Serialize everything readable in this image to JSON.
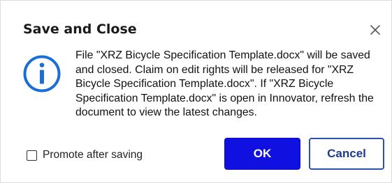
{
  "dialog": {
    "title": "Save and Close",
    "close_icon": "close-icon",
    "info_icon": "info-circle-icon",
    "message": "File \"XRZ Bicycle Specification Template.docx\" will be saved and closed. Claim on edit rights will be released for \"XRZ Bicycle Specification Template.docx\". If \"XRZ Bicycle Specification Template.docx\" is open in Innovator, refresh the document to view the latest changes.",
    "promote_label": "Promote after saving",
    "promote_checked": false,
    "ok_label": "OK",
    "cancel_label": "Cancel"
  },
  "colors": {
    "ok_button": "#1010e0",
    "cancel_border": "#2c4fb0",
    "info_icon": "#1a6fd6"
  }
}
